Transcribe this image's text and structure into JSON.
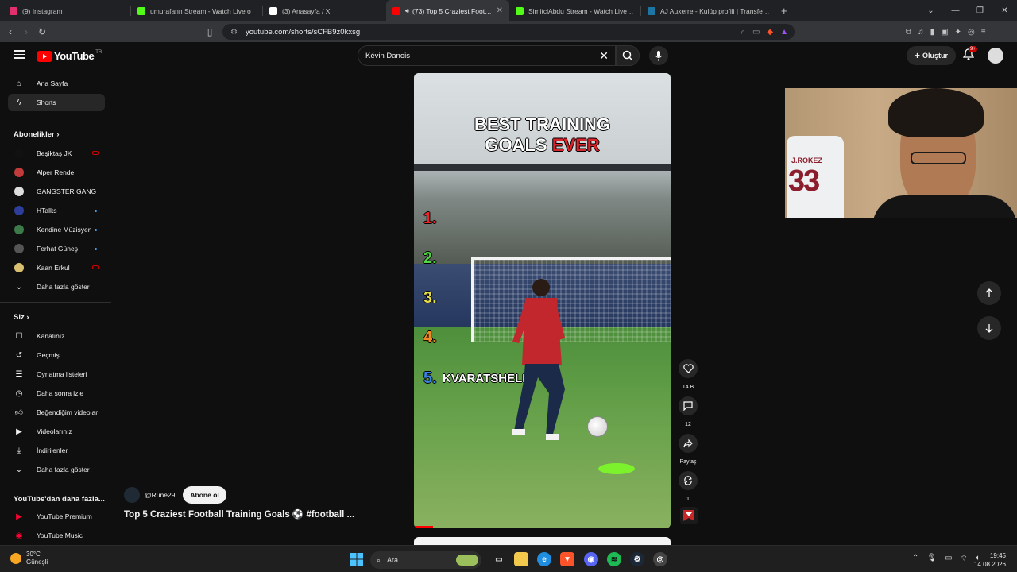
{
  "browser": {
    "tabs": [
      {
        "title": "(9) Instagram",
        "icon": "instagram-icon",
        "color": "#e1306c"
      },
      {
        "title": "umurafann Stream - Watch Live o",
        "icon": "kick-icon",
        "color": "#53fc18"
      },
      {
        "title": "(3) Anasayfa / X",
        "icon": "x-icon",
        "color": "#ffffff"
      },
      {
        "title": "(73) Top 5 Craziest Football Tr",
        "icon": "youtube-icon",
        "color": "#ff0000",
        "active": true
      },
      {
        "title": "SimitciAbdu Stream - Watch Live on",
        "icon": "kick-icon",
        "color": "#53fc18"
      },
      {
        "title": "AJ Auxerre - Kulüp profili | Transferm",
        "icon": "transfermarkt-icon",
        "color": "#1d75a3"
      }
    ],
    "url": "youtube.com/shorts/sCFB9z0kxsg",
    "extension_badge": "9+"
  },
  "youtube": {
    "logo_text": "YouTube",
    "region": "TR",
    "search_value": "Kévin Danois",
    "create_label": "Oluştur",
    "notification_count": "9+"
  },
  "sidebar": {
    "main": [
      {
        "label": "Ana Sayfa",
        "icon": "home-icon"
      },
      {
        "label": "Shorts",
        "icon": "shorts-icon",
        "selected": true
      }
    ],
    "subs_heading": "Abonelikler",
    "subscriptions": [
      {
        "label": "Beşiktaş JK",
        "avatar": "#111111",
        "status": "live"
      },
      {
        "label": "Alper Rende",
        "avatar": "#c23b3b",
        "status": "none"
      },
      {
        "label": "GANGSTER GANG",
        "avatar": "#dddddd",
        "status": "none"
      },
      {
        "label": "HTalks",
        "avatar": "#2c3e9a",
        "status": "dot"
      },
      {
        "label": "Kendine Müzisyen",
        "avatar": "#3c7a4a",
        "status": "dot"
      },
      {
        "label": "Ferhat Güneş",
        "avatar": "#555555",
        "status": "dot"
      },
      {
        "label": "Kaan Erkul",
        "avatar": "#d8c070",
        "status": "live"
      }
    ],
    "subs_more": "Daha fazla göster",
    "you_heading": "Siz",
    "you_items": [
      {
        "label": "Kanalınız",
        "icon": "account-icon"
      },
      {
        "label": "Geçmiş",
        "icon": "history-icon"
      },
      {
        "label": "Oynatma listeleri",
        "icon": "playlist-icon"
      },
      {
        "label": "Daha sonra izle",
        "icon": "clock-icon"
      },
      {
        "label": "Beğendiğim videolar",
        "icon": "like-icon"
      },
      {
        "label": "Videolarınız",
        "icon": "video-icon"
      },
      {
        "label": "İndirilenler",
        "icon": "download-icon"
      }
    ],
    "you_more": "Daha fazla göster",
    "more_heading": "YouTube'dan daha fazla...",
    "more_items": [
      {
        "label": "YouTube Premium",
        "icon": "youtube-premium-icon"
      },
      {
        "label": "YouTube Music",
        "icon": "youtube-music-icon"
      }
    ]
  },
  "short": {
    "title_line1": "BEST TRAINING",
    "title_line2a": "GOALS",
    "title_line2b": "EVER",
    "numbers": [
      {
        "n": "1.",
        "color": "#e8262b"
      },
      {
        "n": "2.",
        "color": "#4fd840"
      },
      {
        "n": "3.",
        "color": "#e8e04a"
      },
      {
        "n": "4.",
        "color": "#f08a24"
      },
      {
        "n": "5.",
        "color": "#3a86e8"
      }
    ],
    "fifth_name": "KVARATSHELIA",
    "channel": "@Rune29",
    "subscribe_label": "Abone ol",
    "video_title": "Top 5 Craziest Football Training Goals ⚽ #football ...",
    "likes": "14 B",
    "comments": "12",
    "share_label": "Paylaş",
    "remix_count": "1"
  },
  "webcam": {
    "jersey_name": "J.ROKEZ",
    "jersey_number": "33"
  },
  "taskbar": {
    "temperature": "30°C",
    "weather_text": "Güneşli",
    "search_placeholder": "Ara",
    "time": "19:45",
    "date": "14.08.2026"
  }
}
